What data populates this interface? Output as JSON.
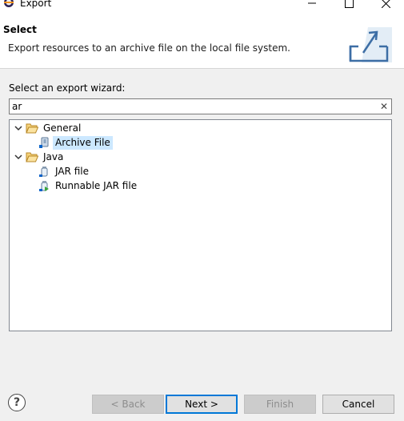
{
  "window": {
    "title": "Export",
    "minimize_icon": "minimize-icon",
    "maximize_icon": "maximize-icon",
    "close_icon": "close-icon"
  },
  "header": {
    "title": "Select",
    "message": "Export resources to an archive file on the local file system.",
    "icon": "export-banner-icon"
  },
  "wizard": {
    "label": "Select an export wizard:",
    "filter_value": "ar",
    "clear_glyph": "✕",
    "tree": [
      {
        "label": "General",
        "expanded": true,
        "children": [
          {
            "label": "Archive File",
            "selected": true
          }
        ]
      },
      {
        "label": "Java",
        "expanded": true,
        "children": [
          {
            "label": "JAR file"
          },
          {
            "label": "Runnable JAR file"
          }
        ]
      }
    ]
  },
  "footer": {
    "help": "?",
    "back": "< Back",
    "next": "Next >",
    "finish": "Finish",
    "cancel": "Cancel"
  },
  "colors": {
    "selection": "#cce8ff",
    "default_button_border": "#0078d7",
    "folder": "#e8b44a"
  }
}
